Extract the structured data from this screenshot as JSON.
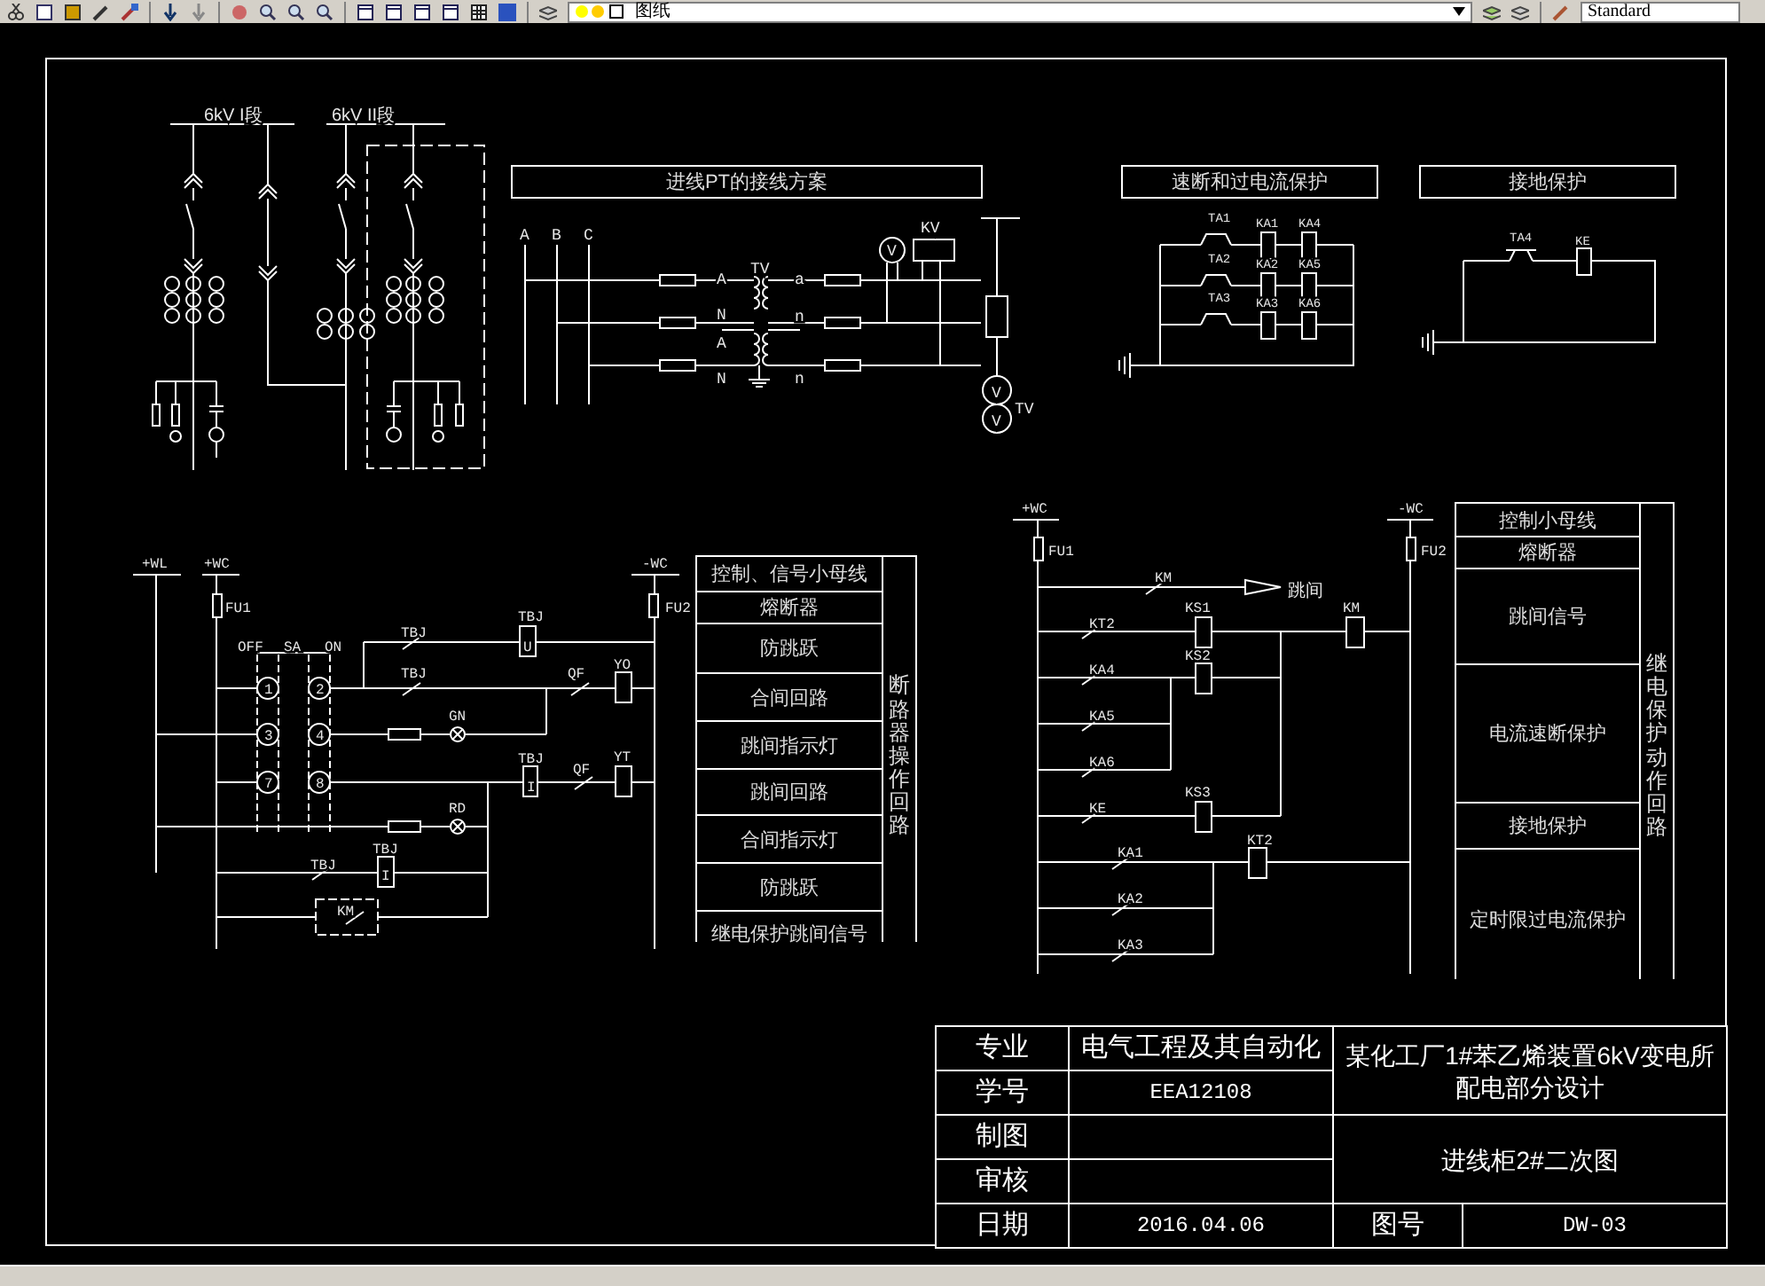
{
  "toolbar": {
    "layer": "图纸",
    "text_style": "Standard"
  },
  "single_line_diagram": {
    "labels": [
      "6kV I段",
      "6kV II段"
    ]
  },
  "pt_wiring": {
    "title": "进线PT的接线方案",
    "labels": [
      "A",
      "B",
      "C",
      "A",
      "N",
      "A",
      "N",
      "TV",
      "a",
      "n",
      "n",
      "V",
      "KV",
      "V",
      "V",
      "TV"
    ]
  },
  "overcurrent_protection": {
    "title": "速断和过电流保护",
    "labels": [
      "TA1",
      "TA2",
      "TA3",
      "KA1",
      "KA2",
      "KA3",
      "KA4",
      "KA5",
      "KA6"
    ]
  },
  "ground_protection": {
    "title": "接地保护",
    "labels": [
      "TA4",
      "KE"
    ]
  },
  "breaker_control_circuit": {
    "labels": [
      "+WL",
      "+WC",
      "FU1",
      "OFF",
      "SA",
      "ON",
      "1",
      "2",
      "3",
      "4",
      "7",
      "8",
      "TBJ",
      "TBJ",
      "U",
      "TBJ",
      "QF",
      "YO",
      "GN",
      "TBJ",
      "I",
      "QF",
      "YT",
      "RD",
      "TBJ",
      "TBJ",
      "I",
      "KM",
      "-WC",
      "FU2"
    ],
    "legend": {
      "rows": [
        "控制、信号小母线",
        "熔断器",
        "防跳跃",
        "合间回路",
        "跳间指示灯",
        "跳间回路",
        "合间指示灯",
        "防跳跃",
        "继电保护跳间信号"
      ],
      "group_label": "断路器操作回路"
    }
  },
  "relay_protection_circuit": {
    "labels": [
      "+WC",
      "FU1",
      "KM",
      "跳间",
      "KS1",
      "KM",
      "KT2",
      "KS2",
      "KA4",
      "KA5",
      "KA6",
      "KS3",
      "KE",
      "KT2",
      "KA1",
      "KA2",
      "KA3",
      "-WC",
      "FU2"
    ],
    "legend": {
      "rows": [
        "控制小母线",
        "熔断器",
        "跳间信号",
        "电流速断保护",
        "接地保护",
        "定时限过电流保护"
      ],
      "group_label": "继电保护动作回路"
    }
  },
  "title_block": {
    "major_label": "专业",
    "major": "电气工程及其自动化",
    "student_id_label": "学号",
    "student_id": "EEA12108",
    "drawn_by_label": "制图",
    "checked_by_label": "审核",
    "date_label": "日期",
    "date": "2016.04.06",
    "project_title": [
      "某化工厂1#苯乙烯装置6kV变电所",
      "配电部分设计"
    ],
    "drawing_title": "进线柜2#二次图",
    "drawing_no_label": "图号",
    "drawing_no": "DW-03"
  }
}
